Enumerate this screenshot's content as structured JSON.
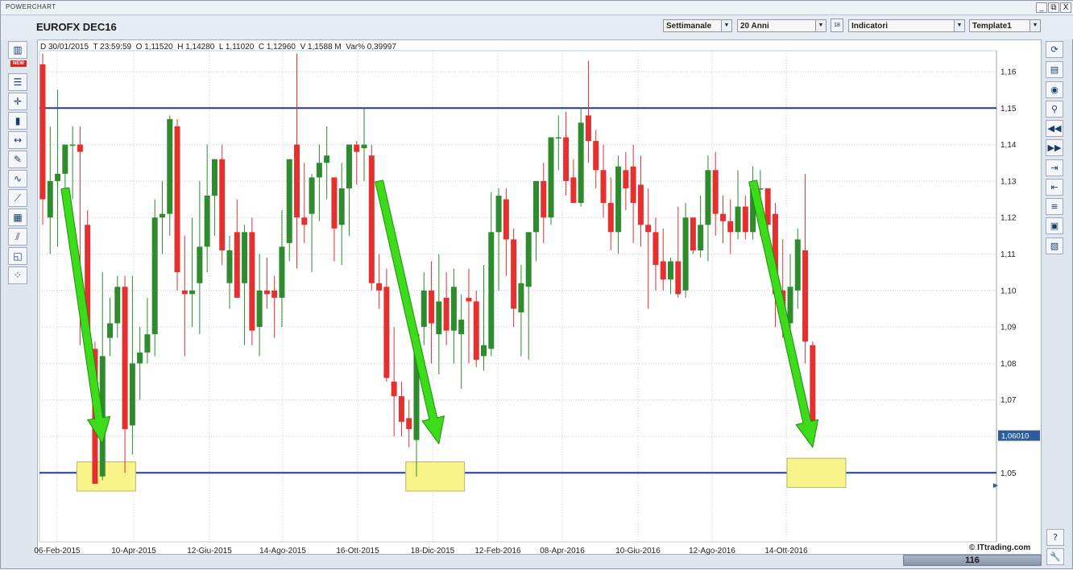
{
  "window": {
    "title": "POWERCHART",
    "buttons": [
      "_",
      "⧉",
      "X"
    ]
  },
  "header": {
    "symbol": "EUROFX DEC16",
    "period": "Settimanale",
    "range": "20 Anni",
    "calendar_label": "18",
    "indicators": "Indicatori",
    "template": "Template1"
  },
  "left_toolbar": {
    "new_badge": "NEW",
    "tools": [
      "layout-icon",
      "new-chart-icon",
      "bar-style-icon",
      "crosshair-icon",
      "candle-icon",
      "horizontal-line-icon",
      "text-tool-icon",
      "trendline-icon",
      "fibonacci-icon",
      "grid-icon",
      "channel-icon",
      "zoom-region-icon",
      "pattern-icon"
    ]
  },
  "right_toolbar": {
    "tools": [
      "refresh-icon",
      "save-icon",
      "camera-icon",
      "search-icon",
      "rewind-icon",
      "fast-forward-icon",
      "expand-icon",
      "contract-icon",
      "list-icon",
      "layout-icon",
      "notes-icon"
    ],
    "bottom": [
      "help-icon",
      "settings-icon"
    ],
    "help_label": "?"
  },
  "infobar": {
    "date": "D 30/01/2015",
    "time": "T 23:59:59",
    "open": "O 1,11520",
    "high": "H 1,14280",
    "low": "L 1,11020",
    "close": "C 1,12960",
    "volume": "V 1,1588 M",
    "var": "Var% 0,39997"
  },
  "current_price": "1,06010",
  "credit": "© ITtrading.com",
  "scroll_value": "116",
  "colors": {
    "up": "#2e8b2e",
    "down": "#e53030",
    "levels": "#1f3d9a",
    "arrows": "#3ddc1a",
    "highlight": "#f8f48a"
  },
  "chart_data": {
    "type": "candlestick",
    "ylim": [
      1.04,
      1.165
    ],
    "y_ticks": [
      "1,16",
      "1,15",
      "1,14",
      "1,13",
      "1,12",
      "1,11",
      "1,10",
      "1,09",
      "1,08",
      "1,07",
      "1,06",
      "1,05"
    ],
    "x_ticks": [
      "06-Feb-2015",
      "10-Apr-2015",
      "12-Giu-2015",
      "14-Ago-2015",
      "16-Ott-2015",
      "18-Dic-2015",
      "12-Feb-2016",
      "08-Apr-2016",
      "10-Giu-2016",
      "12-Ago-2016",
      "14-Ott-2016"
    ],
    "horizontal_levels": [
      1.15,
      1.05
    ],
    "candles": [
      {
        "o": 1.162,
        "h": 1.165,
        "l": 1.118,
        "c": 1.125
      },
      {
        "o": 1.12,
        "h": 1.145,
        "l": 1.11,
        "c": 1.13
      },
      {
        "o": 1.13,
        "h": 1.155,
        "l": 1.112,
        "c": 1.132
      },
      {
        "o": 1.132,
        "h": 1.14,
        "l": 1.12,
        "c": 1.14
      },
      {
        "o": 1.14,
        "h": 1.145,
        "l": 1.125,
        "c": 1.14
      },
      {
        "o": 1.14,
        "h": 1.145,
        "l": 1.085,
        "c": 1.138
      },
      {
        "o": 1.118,
        "h": 1.122,
        "l": 1.085,
        "c": 1.085
      },
      {
        "o": 1.084,
        "h": 1.086,
        "l": 1.047,
        "c": 1.047
      },
      {
        "o": 1.049,
        "h": 1.105,
        "l": 1.048,
        "c": 1.082
      },
      {
        "o": 1.087,
        "h": 1.098,
        "l": 1.082,
        "c": 1.091
      },
      {
        "o": 1.091,
        "h": 1.104,
        "l": 1.087,
        "c": 1.101
      },
      {
        "o": 1.101,
        "h": 1.104,
        "l": 1.05,
        "c": 1.062
      },
      {
        "o": 1.063,
        "h": 1.104,
        "l": 1.055,
        "c": 1.08
      },
      {
        "o": 1.08,
        "h": 1.09,
        "l": 1.07,
        "c": 1.083
      },
      {
        "o": 1.083,
        "h": 1.098,
        "l": 1.08,
        "c": 1.088
      },
      {
        "o": 1.088,
        "h": 1.125,
        "l": 1.082,
        "c": 1.12
      },
      {
        "o": 1.12,
        "h": 1.13,
        "l": 1.11,
        "c": 1.121
      },
      {
        "o": 1.121,
        "h": 1.148,
        "l": 1.115,
        "c": 1.147
      },
      {
        "o": 1.145,
        "h": 1.147,
        "l": 1.1,
        "c": 1.105
      },
      {
        "o": 1.1,
        "h": 1.115,
        "l": 1.082,
        "c": 1.099
      },
      {
        "o": 1.099,
        "h": 1.12,
        "l": 1.09,
        "c": 1.1
      },
      {
        "o": 1.102,
        "h": 1.13,
        "l": 1.088,
        "c": 1.112
      },
      {
        "o": 1.112,
        "h": 1.14,
        "l": 1.105,
        "c": 1.126
      },
      {
        "o": 1.126,
        "h": 1.136,
        "l": 1.115,
        "c": 1.136
      },
      {
        "o": 1.136,
        "h": 1.14,
        "l": 1.107,
        "c": 1.111
      },
      {
        "o": 1.102,
        "h": 1.115,
        "l": 1.095,
        "c": 1.111
      },
      {
        "o": 1.116,
        "h": 1.125,
        "l": 1.098,
        "c": 1.098
      },
      {
        "o": 1.102,
        "h": 1.118,
        "l": 1.085,
        "c": 1.116
      },
      {
        "o": 1.116,
        "h": 1.12,
        "l": 1.085,
        "c": 1.089
      },
      {
        "o": 1.09,
        "h": 1.11,
        "l": 1.082,
        "c": 1.1
      },
      {
        "o": 1.1,
        "h": 1.109,
        "l": 1.095,
        "c": 1.099
      },
      {
        "o": 1.1,
        "h": 1.104,
        "l": 1.087,
        "c": 1.098
      },
      {
        "o": 1.098,
        "h": 1.122,
        "l": 1.09,
        "c": 1.112
      },
      {
        "o": 1.113,
        "h": 1.136,
        "l": 1.108,
        "c": 1.136
      },
      {
        "o": 1.14,
        "h": 1.165,
        "l": 1.106,
        "c": 1.12
      },
      {
        "o": 1.12,
        "h": 1.135,
        "l": 1.113,
        "c": 1.118
      },
      {
        "o": 1.121,
        "h": 1.132,
        "l": 1.105,
        "c": 1.131
      },
      {
        "o": 1.131,
        "h": 1.14,
        "l": 1.119,
        "c": 1.135
      },
      {
        "o": 1.135,
        "h": 1.145,
        "l": 1.125,
        "c": 1.137
      },
      {
        "o": 1.131,
        "h": 1.13,
        "l": 1.108,
        "c": 1.117
      },
      {
        "o": 1.118,
        "h": 1.135,
        "l": 1.107,
        "c": 1.128
      },
      {
        "o": 1.128,
        "h": 1.14,
        "l": 1.115,
        "c": 1.14
      },
      {
        "o": 1.14,
        "h": 1.141,
        "l": 1.129,
        "c": 1.138
      },
      {
        "o": 1.139,
        "h": 1.15,
        "l": 1.13,
        "c": 1.14
      },
      {
        "o": 1.137,
        "h": 1.14,
        "l": 1.1,
        "c": 1.102
      },
      {
        "o": 1.102,
        "h": 1.11,
        "l": 1.095,
        "c": 1.1
      },
      {
        "o": 1.101,
        "h": 1.106,
        "l": 1.075,
        "c": 1.076
      },
      {
        "o": 1.075,
        "h": 1.09,
        "l": 1.06,
        "c": 1.071
      },
      {
        "o": 1.071,
        "h": 1.075,
        "l": 1.06,
        "c": 1.064
      },
      {
        "o": 1.065,
        "h": 1.07,
        "l": 1.057,
        "c": 1.062
      },
      {
        "o": 1.059,
        "h": 1.09,
        "l": 1.049,
        "c": 1.088
      },
      {
        "o": 1.09,
        "h": 1.105,
        "l": 1.085,
        "c": 1.1
      },
      {
        "o": 1.1,
        "h": 1.108,
        "l": 1.08,
        "c": 1.091
      },
      {
        "o": 1.088,
        "h": 1.11,
        "l": 1.077,
        "c": 1.097
      },
      {
        "o": 1.098,
        "h": 1.105,
        "l": 1.085,
        "c": 1.089
      },
      {
        "o": 1.089,
        "h": 1.106,
        "l": 1.08,
        "c": 1.101
      },
      {
        "o": 1.088,
        "h": 1.099,
        "l": 1.073,
        "c": 1.092
      },
      {
        "o": 1.098,
        "h": 1.106,
        "l": 1.08,
        "c": 1.097
      },
      {
        "o": 1.097,
        "h": 1.1,
        "l": 1.079,
        "c": 1.081
      },
      {
        "o": 1.082,
        "h": 1.107,
        "l": 1.078,
        "c": 1.085
      },
      {
        "o": 1.084,
        "h": 1.127,
        "l": 1.082,
        "c": 1.116
      },
      {
        "o": 1.116,
        "h": 1.128,
        "l": 1.1,
        "c": 1.126
      },
      {
        "o": 1.125,
        "h": 1.128,
        "l": 1.104,
        "c": 1.114
      },
      {
        "o": 1.114,
        "h": 1.117,
        "l": 1.09,
        "c": 1.095
      },
      {
        "o": 1.094,
        "h": 1.107,
        "l": 1.082,
        "c": 1.102
      },
      {
        "o": 1.101,
        "h": 1.116,
        "l": 1.081,
        "c": 1.116
      },
      {
        "o": 1.116,
        "h": 1.127,
        "l": 1.108,
        "c": 1.13
      },
      {
        "o": 1.13,
        "h": 1.135,
        "l": 1.113,
        "c": 1.12
      },
      {
        "o": 1.12,
        "h": 1.142,
        "l": 1.118,
        "c": 1.142
      },
      {
        "o": 1.142,
        "h": 1.148,
        "l": 1.133,
        "c": 1.142
      },
      {
        "o": 1.142,
        "h": 1.149,
        "l": 1.126,
        "c": 1.13
      },
      {
        "o": 1.131,
        "h": 1.136,
        "l": 1.124,
        "c": 1.124
      },
      {
        "o": 1.124,
        "h": 1.15,
        "l": 1.123,
        "c": 1.146
      },
      {
        "o": 1.148,
        "h": 1.163,
        "l": 1.135,
        "c": 1.141
      },
      {
        "o": 1.141,
        "h": 1.144,
        "l": 1.128,
        "c": 1.133
      },
      {
        "o": 1.133,
        "h": 1.14,
        "l": 1.12,
        "c": 1.124
      },
      {
        "o": 1.124,
        "h": 1.131,
        "l": 1.111,
        "c": 1.116
      },
      {
        "o": 1.116,
        "h": 1.137,
        "l": 1.11,
        "c": 1.134
      },
      {
        "o": 1.133,
        "h": 1.138,
        "l": 1.122,
        "c": 1.128
      },
      {
        "o": 1.134,
        "h": 1.14,
        "l": 1.113,
        "c": 1.124
      },
      {
        "o": 1.129,
        "h": 1.137,
        "l": 1.112,
        "c": 1.118
      },
      {
        "o": 1.118,
        "h": 1.128,
        "l": 1.095,
        "c": 1.116
      },
      {
        "o": 1.116,
        "h": 1.12,
        "l": 1.1,
        "c": 1.107
      },
      {
        "o": 1.108,
        "h": 1.117,
        "l": 1.1,
        "c": 1.103
      },
      {
        "o": 1.103,
        "h": 1.109,
        "l": 1.099,
        "c": 1.108
      },
      {
        "o": 1.108,
        "h": 1.123,
        "l": 1.098,
        "c": 1.099
      },
      {
        "o": 1.1,
        "h": 1.124,
        "l": 1.098,
        "c": 1.12
      },
      {
        "o": 1.12,
        "h": 1.12,
        "l": 1.11,
        "c": 1.111
      },
      {
        "o": 1.111,
        "h": 1.126,
        "l": 1.109,
        "c": 1.118
      },
      {
        "o": 1.118,
        "h": 1.137,
        "l": 1.108,
        "c": 1.133
      },
      {
        "o": 1.133,
        "h": 1.138,
        "l": 1.115,
        "c": 1.121
      },
      {
        "o": 1.121,
        "h": 1.126,
        "l": 1.113,
        "c": 1.119
      },
      {
        "o": 1.119,
        "h": 1.125,
        "l": 1.11,
        "c": 1.116
      },
      {
        "o": 1.116,
        "h": 1.133,
        "l": 1.114,
        "c": 1.123
      },
      {
        "o": 1.123,
        "h": 1.126,
        "l": 1.114,
        "c": 1.116
      },
      {
        "o": 1.116,
        "h": 1.134,
        "l": 1.114,
        "c": 1.128
      },
      {
        "o": 1.128,
        "h": 1.133,
        "l": 1.115,
        "c": 1.128
      },
      {
        "o": 1.128,
        "h": 1.128,
        "l": 1.115,
        "c": 1.118
      },
      {
        "o": 1.121,
        "h": 1.124,
        "l": 1.09,
        "c": 1.099
      },
      {
        "o": 1.1,
        "h": 1.114,
        "l": 1.087,
        "c": 1.091
      },
      {
        "o": 1.091,
        "h": 1.11,
        "l": 1.087,
        "c": 1.101
      },
      {
        "o": 1.1,
        "h": 1.117,
        "l": 1.095,
        "c": 1.114
      },
      {
        "o": 1.111,
        "h": 1.132,
        "l": 1.08,
        "c": 1.086
      },
      {
        "o": 1.085,
        "h": 1.086,
        "l": 1.058,
        "c": 1.06
      }
    ]
  },
  "annotations": {
    "arrows": [
      {
        "x1": 3,
        "y1": 1.128,
        "x2": 8,
        "y2": 1.058
      },
      {
        "x1": 45,
        "y1": 1.13,
        "x2": 53,
        "y2": 1.058
      },
      {
        "x1": 95,
        "y1": 1.13,
        "x2": 103,
        "y2": 1.057
      }
    ],
    "highlights": [
      {
        "from": 5,
        "to": 12,
        "y_high": 1.053,
        "y_low": 1.045
      },
      {
        "from": 49,
        "to": 56,
        "y_high": 1.053,
        "y_low": 1.045
      },
      {
        "from": 100,
        "to": 107,
        "y_high": 1.054,
        "y_low": 1.046
      }
    ]
  }
}
